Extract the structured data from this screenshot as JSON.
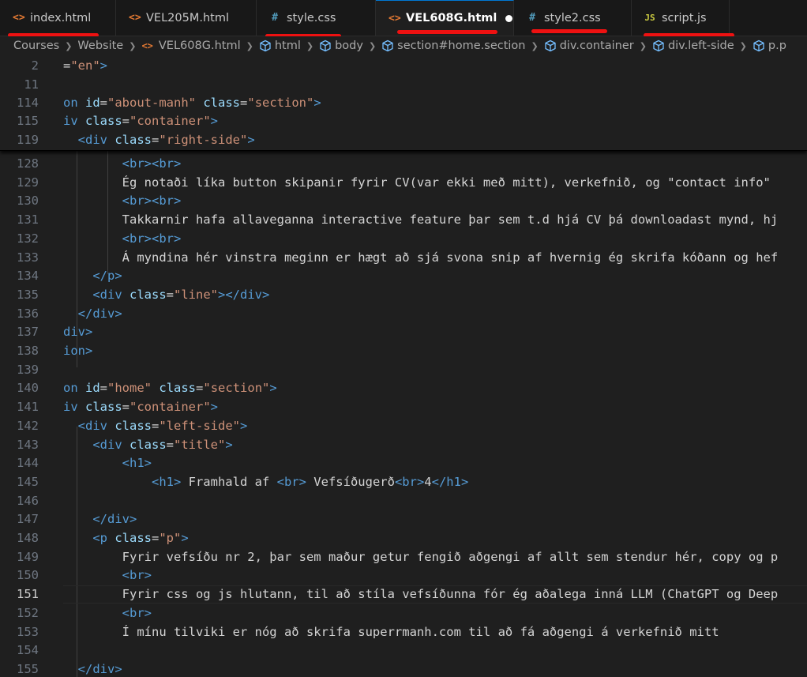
{
  "tabs": [
    {
      "label": "index.html",
      "icon": "html-file-icon",
      "active": false,
      "modified": false
    },
    {
      "label": "VEL205M.html",
      "icon": "html-file-icon",
      "active": false,
      "modified": false
    },
    {
      "label": "style.css",
      "icon": "css-file-icon",
      "active": false,
      "modified": false
    },
    {
      "label": "VEL608G.html",
      "icon": "html-file-icon",
      "active": true,
      "modified": true
    },
    {
      "label": "style2.css",
      "icon": "css-file-icon",
      "active": false,
      "modified": false
    },
    {
      "label": "script.js",
      "icon": "js-file-icon",
      "active": false,
      "modified": false
    }
  ],
  "tab_icon_glyphs": {
    "html": "<>",
    "css": "#",
    "js": "JS"
  },
  "annotation_color": "#ee1111",
  "breadcrumb": [
    "Courses",
    "Website",
    "VEL608G.html",
    "html",
    "body",
    "section#home.section",
    "div.container",
    "div.left-side",
    "p.p"
  ],
  "sticky_lines": [
    {
      "num": "2",
      "segments": [
        [
          "x",
          "="
        ],
        [
          "s",
          "\"en\""
        ],
        [
          "t",
          ">"
        ]
      ]
    },
    {
      "num": "11",
      "segments": []
    },
    {
      "num": "114",
      "segments": [
        [
          "t",
          "on "
        ],
        [
          "a",
          "id"
        ],
        [
          "x",
          "="
        ],
        [
          "s",
          "\"about-manh\""
        ],
        [
          "x",
          " "
        ],
        [
          "a",
          "class"
        ],
        [
          "x",
          "="
        ],
        [
          "s",
          "\"section\""
        ],
        [
          "t",
          ">"
        ]
      ]
    },
    {
      "num": "115",
      "segments": [
        [
          "t",
          "iv "
        ],
        [
          "a",
          "class"
        ],
        [
          "x",
          "="
        ],
        [
          "s",
          "\"container\""
        ],
        [
          "t",
          ">"
        ]
      ]
    },
    {
      "num": "119",
      "segments": [
        [
          "x",
          "  "
        ],
        [
          "t",
          "<div "
        ],
        [
          "a",
          "class"
        ],
        [
          "x",
          "="
        ],
        [
          "s",
          "\"right-side\""
        ],
        [
          "t",
          ">"
        ]
      ]
    }
  ],
  "lines": [
    {
      "num": "128",
      "segments": [
        [
          "x",
          "        "
        ],
        [
          "t",
          "<br><br>"
        ]
      ]
    },
    {
      "num": "129",
      "segments": [
        [
          "x",
          "        Ég notaði líka button skipanir fyrir CV(var ekki með mitt), verkefnið, og \"contact info\" "
        ]
      ]
    },
    {
      "num": "130",
      "segments": [
        [
          "x",
          "        "
        ],
        [
          "t",
          "<br><br>"
        ]
      ]
    },
    {
      "num": "131",
      "segments": [
        [
          "x",
          "        Takkarnir hafa allaveganna interactive feature þar sem t.d hjá CV þá downloadast mynd, hj"
        ]
      ]
    },
    {
      "num": "132",
      "segments": [
        [
          "x",
          "        "
        ],
        [
          "t",
          "<br><br>"
        ]
      ]
    },
    {
      "num": "133",
      "segments": [
        [
          "x",
          "        Á myndina hér vinstra meginn er hægt að sjá svona snip af hvernig ég skrifa kóðann og hef"
        ]
      ]
    },
    {
      "num": "134",
      "segments": [
        [
          "x",
          "    "
        ],
        [
          "t",
          "</p>"
        ]
      ]
    },
    {
      "num": "135",
      "segments": [
        [
          "x",
          "    "
        ],
        [
          "t",
          "<div "
        ],
        [
          "a",
          "class"
        ],
        [
          "x",
          "="
        ],
        [
          "s",
          "\"line\""
        ],
        [
          "t",
          "></div>"
        ]
      ]
    },
    {
      "num": "136",
      "segments": [
        [
          "x",
          "  "
        ],
        [
          "t",
          "</div>"
        ]
      ]
    },
    {
      "num": "137",
      "segments": [
        [
          "t",
          "div>"
        ]
      ]
    },
    {
      "num": "138",
      "segments": [
        [
          "t",
          "ion>"
        ]
      ]
    },
    {
      "num": "139",
      "segments": []
    },
    {
      "num": "140",
      "segments": [
        [
          "t",
          "on "
        ],
        [
          "a",
          "id"
        ],
        [
          "x",
          "="
        ],
        [
          "s",
          "\"home\""
        ],
        [
          "x",
          " "
        ],
        [
          "a",
          "class"
        ],
        [
          "x",
          "="
        ],
        [
          "s",
          "\"section\""
        ],
        [
          "t",
          ">"
        ]
      ]
    },
    {
      "num": "141",
      "segments": [
        [
          "t",
          "iv "
        ],
        [
          "a",
          "class"
        ],
        [
          "x",
          "="
        ],
        [
          "s",
          "\"container\""
        ],
        [
          "t",
          ">"
        ]
      ]
    },
    {
      "num": "142",
      "segments": [
        [
          "x",
          "  "
        ],
        [
          "t",
          "<div "
        ],
        [
          "a",
          "class"
        ],
        [
          "x",
          "="
        ],
        [
          "s",
          "\"left-side\""
        ],
        [
          "t",
          ">"
        ]
      ]
    },
    {
      "num": "143",
      "segments": [
        [
          "x",
          "    "
        ],
        [
          "t",
          "<div "
        ],
        [
          "a",
          "class"
        ],
        [
          "x",
          "="
        ],
        [
          "s",
          "\"title\""
        ],
        [
          "t",
          ">"
        ]
      ]
    },
    {
      "num": "144",
      "segments": [
        [
          "x",
          "        "
        ],
        [
          "t",
          "<h1>"
        ]
      ]
    },
    {
      "num": "145",
      "segments": [
        [
          "x",
          "            "
        ],
        [
          "t",
          "<h1>"
        ],
        [
          "x",
          " Framhald af "
        ],
        [
          "t",
          "<br>"
        ],
        [
          "x",
          " Vefsíðugerð"
        ],
        [
          "t",
          "<br>"
        ],
        [
          "x",
          "4"
        ],
        [
          "t",
          "</h1>"
        ]
      ]
    },
    {
      "num": "146",
      "segments": []
    },
    {
      "num": "147",
      "segments": [
        [
          "x",
          "    "
        ],
        [
          "t",
          "</div>"
        ]
      ]
    },
    {
      "num": "148",
      "segments": [
        [
          "x",
          "    "
        ],
        [
          "t",
          "<p "
        ],
        [
          "a",
          "class"
        ],
        [
          "x",
          "="
        ],
        [
          "s",
          "\"p\""
        ],
        [
          "t",
          ">"
        ]
      ]
    },
    {
      "num": "149",
      "segments": [
        [
          "x",
          "        Fyrir vefsíðu nr 2, þar sem maður getur fengið aðgengi af allt sem stendur hér, copy og p"
        ]
      ]
    },
    {
      "num": "150",
      "segments": [
        [
          "x",
          "        "
        ],
        [
          "t",
          "<br>"
        ]
      ]
    },
    {
      "num": "151",
      "segments": [
        [
          "x",
          "        Fyrir css og js hlutann, til að stíla vefsíðunna fór ég aðalega inná LLM (ChatGPT og Deep"
        ]
      ],
      "current": true
    },
    {
      "num": "152",
      "segments": [
        [
          "x",
          "        "
        ],
        [
          "t",
          "<br>"
        ]
      ]
    },
    {
      "num": "153",
      "segments": [
        [
          "x",
          "        Í mínu tilviki er nóg að skrifa superrmanh.com til að fá aðgengi á verkefnið mitt"
        ]
      ]
    },
    {
      "num": "154",
      "segments": []
    },
    {
      "num": "155",
      "segments": [
        [
          "x",
          "  "
        ],
        [
          "t",
          "</div>"
        ]
      ]
    }
  ]
}
